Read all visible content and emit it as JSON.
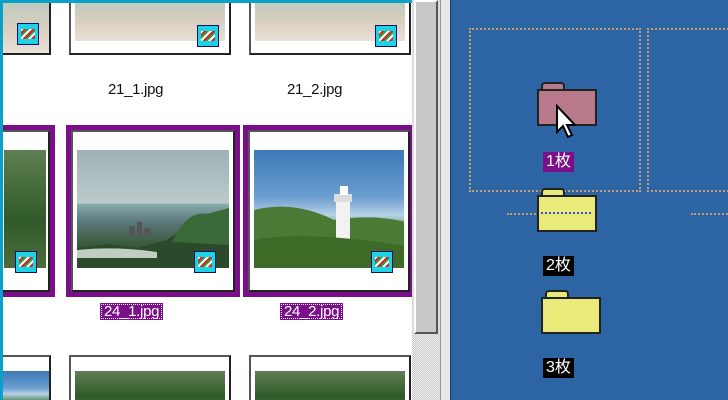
{
  "files": {
    "row1": [
      {
        "name": "21_1.jpg"
      },
      {
        "name": "21_2.jpg"
      }
    ],
    "row2": [
      {
        "name": "24_1.jpg",
        "selected": true
      },
      {
        "name": "24_2.jpg",
        "selected": true
      }
    ]
  },
  "folders": [
    {
      "label": "1枚",
      "state": "hover"
    },
    {
      "label": "2枚",
      "state": "drop-target"
    },
    {
      "label": "3枚",
      "state": "normal"
    }
  ],
  "colors": {
    "selection": "#7b0f8a",
    "panel": "#2d64a3",
    "folder": "#eaea7a",
    "folder_hover": "#b87a8a",
    "badge": "#1fd3e6"
  },
  "icons": [
    "image-badge-icon",
    "folder-icon",
    "mouse-pointer-icon"
  ]
}
